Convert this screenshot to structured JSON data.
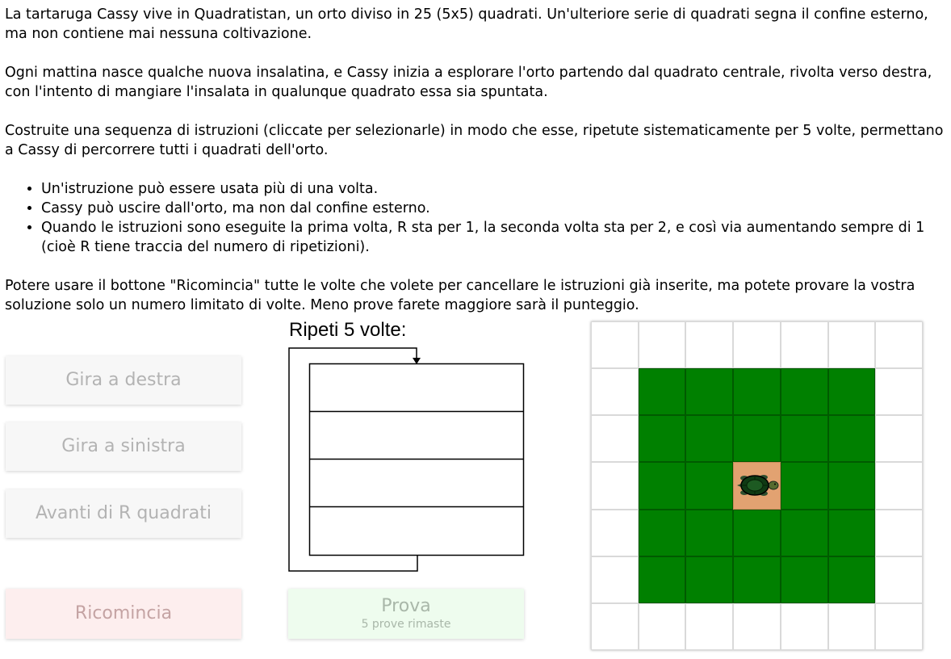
{
  "instructions": {
    "p1": "La tartaruga Cassy vive in Quadratistan, un orto diviso in 25 (5x5) quadrati. Un'ulteriore serie di quadrati segna il confine esterno, ma non contiene mai nessuna coltivazione.",
    "p2": "Ogni mattina nasce qualche nuova insalatina, e Cassy inizia a esplorare l'orto partendo dal quadrato centrale, rivolta verso destra, con l'intento di mangiare l'insalata in qualunque quadrato essa sia spuntata.",
    "p3": "Costruite una sequenza di istruzioni (cliccate per selezionarle) in modo che esse, ripetute sistematicamente per 5 volte, permettano a Cassy di percorrere tutti i quadrati dell'orto.",
    "rules": [
      "Un'istruzione può essere usata più di una volta.",
      "Cassy può uscire dall'orto, ma non dal confine esterno.",
      "Quando le istruzioni sono eseguite la prima volta, R sta per 1, la seconda volta sta per 2, e così via aumentando sempre di 1 (cioè R tiene traccia del numero di ripetizioni)."
    ],
    "p4": "Potere usare il bottone \"Ricomincia\" tutte le volte che volete per cancellare le istruzioni già inserite, ma potete provare la vostra soluzione solo un numero limitato di volte. Meno prove farete maggiore sarà il punteggio."
  },
  "commands": {
    "turn_right": "Gira a destra",
    "turn_left": "Gira a sinistra",
    "forward": "Avanti di R quadrati"
  },
  "loop": {
    "title": "Ripeti 5 volte:",
    "slots": [
      "",
      "",
      "",
      ""
    ]
  },
  "actions": {
    "reset": "Ricomincia",
    "try": "Prova",
    "tries_left": "5 prove rimaste"
  },
  "board": {
    "rows": 7,
    "cols": 7,
    "garden_color": "#008000",
    "start_color": "#e2a271",
    "border_color": "#ffffff",
    "turtle_direction": "right",
    "turtle_icon": "turtle-icon"
  }
}
